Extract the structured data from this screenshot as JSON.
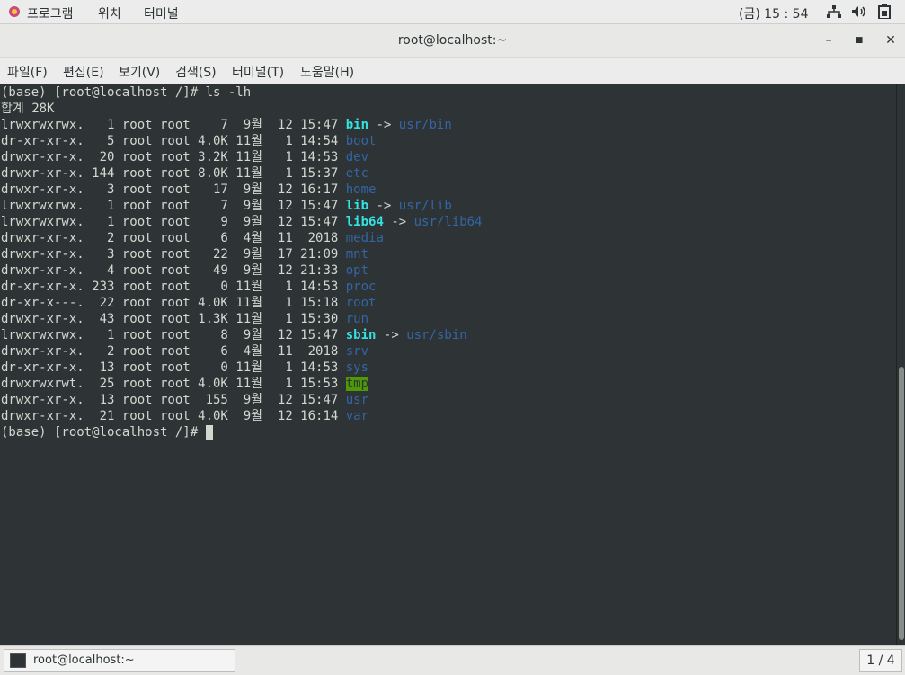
{
  "top_panel": {
    "applications": "프로그램",
    "places": "위치",
    "terminal_app": "터미널",
    "clock": "(금) 15 : 54"
  },
  "window": {
    "title": "root@localhost:~",
    "minimize": "–",
    "maximize": "■",
    "close": "✕"
  },
  "menu": {
    "file": "파일(F)",
    "edit": "편집(E)",
    "view": "보기(V)",
    "search": "검색(S)",
    "terminal": "터미널(T)",
    "help": "도움말(H)"
  },
  "terminal": {
    "prompt": "(base) [root@localhost /]# ",
    "command": "ls -lh",
    "total": "합계 28K",
    "arrow": " -> ",
    "entries": [
      {
        "meta": "lrwxrwxrwx.   1 root root    7  9월  12 15:47 ",
        "name": "bin",
        "target": "usr/bin"
      },
      {
        "meta": "dr-xr-xr-x.   5 root root 4.0K 11월   1 14:54 ",
        "name": "boot"
      },
      {
        "meta": "drwxr-xr-x.  20 root root 3.2K 11월   1 14:53 ",
        "name": "dev"
      },
      {
        "meta": "drwxr-xr-x. 144 root root 8.0K 11월   1 15:37 ",
        "name": "etc"
      },
      {
        "meta": "drwxr-xr-x.   3 root root   17  9월  12 16:17 ",
        "name": "home"
      },
      {
        "meta": "lrwxrwxrwx.   1 root root    7  9월  12 15:47 ",
        "name": "lib",
        "target": "usr/lib"
      },
      {
        "meta": "lrwxrwxrwx.   1 root root    9  9월  12 15:47 ",
        "name": "lib64",
        "target": "usr/lib64"
      },
      {
        "meta": "drwxr-xr-x.   2 root root    6  4월  11  2018 ",
        "name": "media"
      },
      {
        "meta": "drwxr-xr-x.   3 root root   22  9월  17 21:09 ",
        "name": "mnt"
      },
      {
        "meta": "drwxr-xr-x.   4 root root   49  9월  12 21:33 ",
        "name": "opt"
      },
      {
        "meta": "dr-xr-xr-x. 233 root root    0 11월   1 14:53 ",
        "name": "proc"
      },
      {
        "meta": "dr-xr-x---.  22 root root 4.0K 11월   1 15:18 ",
        "name": "root"
      },
      {
        "meta": "drwxr-xr-x.  43 root root 1.3K 11월   1 15:30 ",
        "name": "run"
      },
      {
        "meta": "lrwxrwxrwx.   1 root root    8  9월  12 15:47 ",
        "name": "sbin",
        "target": "usr/sbin"
      },
      {
        "meta": "drwxr-xr-x.   2 root root    6  4월  11  2018 ",
        "name": "srv"
      },
      {
        "meta": "dr-xr-xr-x.  13 root root    0 11월   1 14:53 ",
        "name": "sys"
      },
      {
        "meta": "drwxrwxrwt.  25 root root 4.0K 11월   1 15:53 ",
        "name": "tmp"
      },
      {
        "meta": "drwxr-xr-x.  13 root root  155  9월  12 15:47 ",
        "name": "usr"
      },
      {
        "meta": "drwxr-xr-x.  21 root root 4.0K  9월  12 16:14 ",
        "name": "var"
      }
    ]
  },
  "taskbar": {
    "task_label": "root@localhost:~",
    "workspace": "1 / 4"
  },
  "colors": {
    "terminal_bg": "#2e3436",
    "text": "#d3d7cf",
    "symlink": "#34e2e2",
    "directory": "#3465a4",
    "sticky_bg": "#4e9a06"
  }
}
